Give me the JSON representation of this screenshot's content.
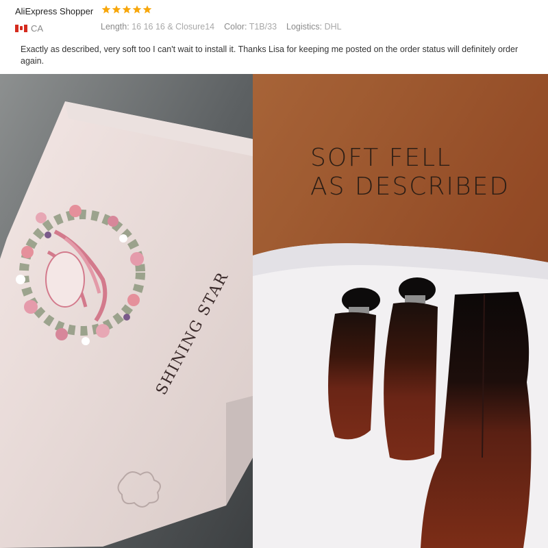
{
  "review": {
    "reviewer": "AliExpress Shopper",
    "rating": 5,
    "country": "CA",
    "attributes": [
      {
        "key": "Length:",
        "value": "16 16 16 & Closure14"
      },
      {
        "key": "Color:",
        "value": "T1B/33"
      },
      {
        "key": "Logistics:",
        "value": "DHL"
      }
    ],
    "text": "Exactly as described, very soft too I can't wait to install it. Thanks Lisa for keeping me posted on the order status will definitely order again."
  },
  "photos": {
    "left": {
      "box_brand": "SHINING STAR"
    },
    "right": {
      "overlay_line1": "SOFT FELL",
      "overlay_line2": "AS DESCRIBED"
    }
  },
  "colors": {
    "star": "#f7a70b",
    "flag_red": "#d52b1e"
  }
}
